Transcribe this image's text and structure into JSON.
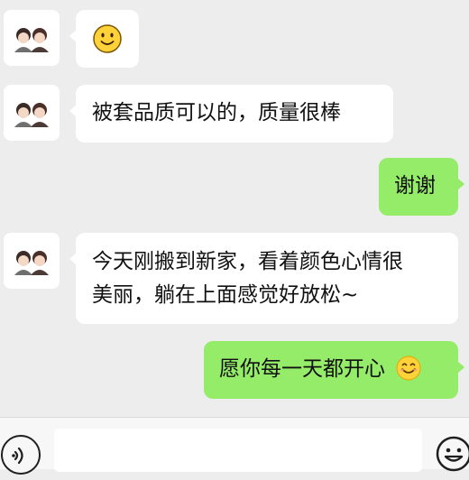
{
  "messages": [
    {
      "side": "in",
      "text": "",
      "emoji": "slightly-smiling-face"
    },
    {
      "side": "in",
      "text": "被套品质可以的，质量很棒"
    },
    {
      "side": "out",
      "text": "谢谢"
    },
    {
      "side": "in",
      "line1": "今天刚搬到新家，看着颜色心情很",
      "line2": "美丽，躺在上面感觉好放松~"
    },
    {
      "side": "out",
      "text": "愿你每一天都开心",
      "emoji": "smiling-face-with-smiling-eyes"
    }
  ],
  "input_bar": {
    "placeholder": "",
    "left_icon": "voice-icon",
    "right_icon": "emoji-icon"
  },
  "colors": {
    "background": "#ededed",
    "incoming_bubble": "#ffffff",
    "outgoing_bubble": "#95ec69"
  }
}
